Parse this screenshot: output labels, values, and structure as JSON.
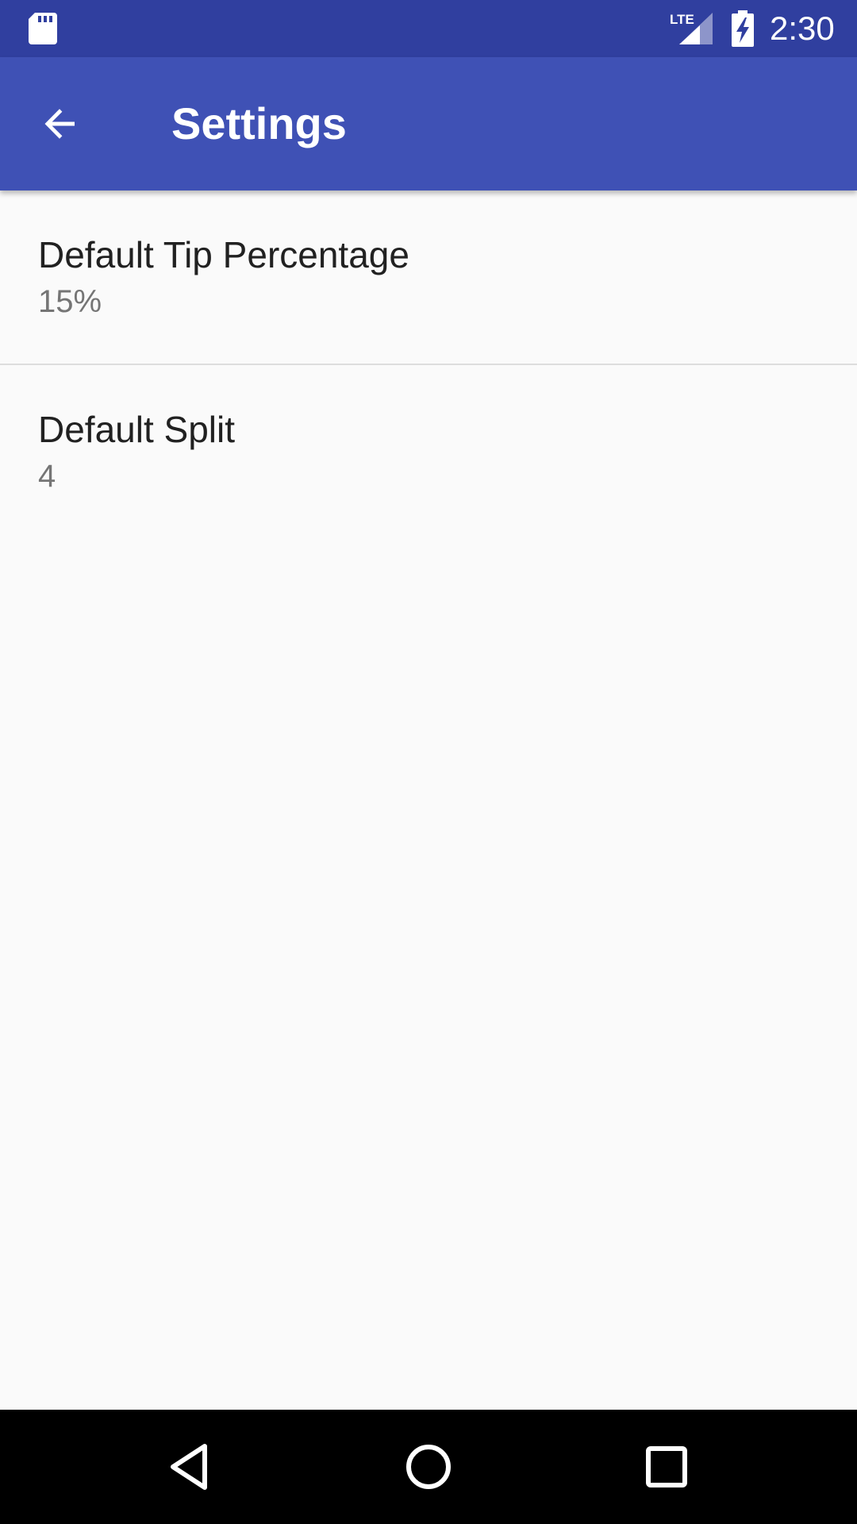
{
  "status_bar": {
    "time": "2:30",
    "network_label": "LTE",
    "icons": [
      "sd-card-icon",
      "lte-signal-icon",
      "battery-charging-icon"
    ]
  },
  "app_bar": {
    "title": "Settings",
    "back_icon": "arrow-back-icon"
  },
  "preferences": [
    {
      "title": "Default Tip Percentage",
      "summary": "15%"
    },
    {
      "title": "Default Split",
      "summary": "4"
    }
  ],
  "nav_bar": {
    "icons": [
      "back-triangle-icon",
      "home-circle-icon",
      "recents-square-icon"
    ]
  },
  "colors": {
    "status_bar": "#303F9F",
    "app_bar": "#3F51B5",
    "background": "#FAFAFA",
    "title_text": "#212121",
    "summary_text": "#757575"
  }
}
